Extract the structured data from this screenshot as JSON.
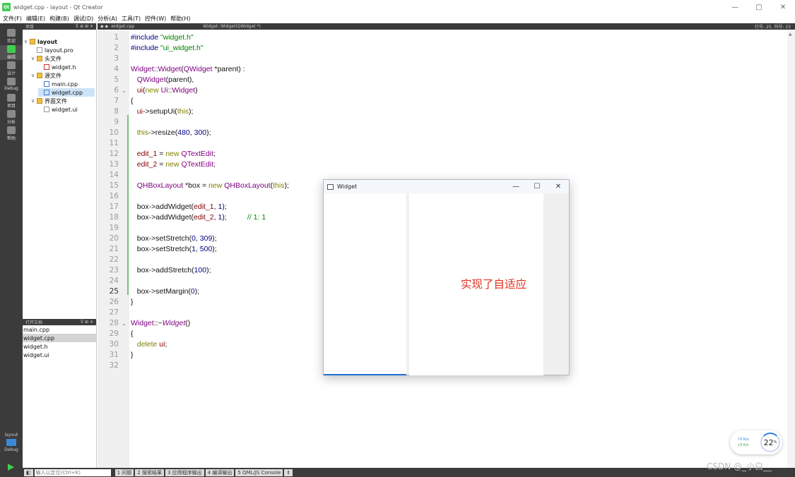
{
  "window": {
    "title": "widget.cpp - layout - Qt Creator",
    "app_icon": "Qt",
    "controls": [
      "—",
      "▢",
      "✕"
    ]
  },
  "menu": [
    "文件(F)",
    "编辑(E)",
    "构建(B)",
    "调试(D)",
    "分析(A)",
    "工具(T)",
    "控件(W)",
    "帮助(H)"
  ],
  "modes": [
    {
      "label": "欢迎",
      "active": false
    },
    {
      "label": "编辑",
      "active": true
    },
    {
      "label": "设计",
      "active": false
    },
    {
      "label": "Debug",
      "active": false
    },
    {
      "label": "项目",
      "active": false
    },
    {
      "label": "分析",
      "active": false
    },
    {
      "label": "帮助",
      "active": false
    }
  ],
  "kit": {
    "project": "layout",
    "config": "Debug"
  },
  "project_pane": {
    "header": "项目",
    "tree": [
      {
        "label": "layout",
        "depth": 0,
        "toggle": "∨",
        "icon": "project-folder-icon",
        "bold": true
      },
      {
        "label": "layout.pro",
        "depth": 1,
        "toggle": "",
        "icon": "pro-file-icon"
      },
      {
        "label": "头文件",
        "depth": 1,
        "toggle": "∨",
        "icon": "folder-icon"
      },
      {
        "label": "widget.h",
        "depth": 2,
        "toggle": "",
        "icon": "header-file-icon"
      },
      {
        "label": "源文件",
        "depth": 1,
        "toggle": "∨",
        "icon": "folder-icon"
      },
      {
        "label": "main.cpp",
        "depth": 2,
        "toggle": "",
        "icon": "cpp-file-icon"
      },
      {
        "label": "widget.cpp",
        "depth": 2,
        "toggle": "",
        "icon": "cpp-file-icon",
        "selected": true
      },
      {
        "label": "界面文件",
        "depth": 1,
        "toggle": "∨",
        "icon": "folder-icon"
      },
      {
        "label": "widget.ui",
        "depth": 2,
        "toggle": "",
        "icon": "ui-file-icon"
      }
    ]
  },
  "open_docs": {
    "header": "打开文档",
    "items": [
      {
        "label": "main.cpp",
        "selected": false
      },
      {
        "label": "widget.cpp",
        "selected": true
      },
      {
        "label": "widget.h",
        "selected": false
      },
      {
        "label": "widget.ui",
        "selected": false
      }
    ]
  },
  "editor": {
    "file": "widget.cpp",
    "function": "Widget::Widget(QWidget *)",
    "position": "行号: 25, 列号: 23",
    "current_line": 25,
    "line_numbers": [
      "1",
      "2",
      "3",
      "4",
      "5",
      "6",
      "7",
      "8",
      "9",
      "10",
      "11",
      "12",
      "13",
      "14",
      "15",
      "16",
      "17",
      "18",
      "19",
      "20",
      "21",
      "22",
      "23",
      "24",
      "25",
      "26",
      "27",
      "28",
      "29",
      "30",
      "31",
      "32"
    ],
    "folds": [
      {
        "line": 6,
        "symbol": "⌄"
      },
      {
        "line": 28,
        "symbol": "⌄"
      }
    ],
    "lines": [
      [
        [
          "#include ",
          "nm"
        ],
        [
          "\"widget.h\"",
          "st"
        ]
      ],
      [
        [
          "#include ",
          "nm"
        ],
        [
          "\"ui_widget.h\"",
          "st"
        ]
      ],
      [],
      [
        [
          "Widget",
          "ty"
        ],
        [
          "::",
          ""
        ],
        [
          "Widget",
          "ty"
        ],
        [
          "(",
          ""
        ],
        [
          "QWidget",
          "ty"
        ],
        [
          " *parent) :",
          ""
        ]
      ],
      [
        [
          "   ",
          ""
        ],
        [
          "QWidget",
          "ty"
        ],
        [
          "(parent),",
          ""
        ]
      ],
      [
        [
          "   ",
          ""
        ],
        [
          "ui",
          "vr"
        ],
        [
          "(",
          ""
        ],
        [
          "new ",
          "kw"
        ],
        [
          "Ui",
          "ty"
        ],
        [
          "::",
          ""
        ],
        [
          "Widget",
          "ty"
        ],
        [
          ")",
          ""
        ]
      ],
      [
        [
          "{",
          ""
        ]
      ],
      [
        [
          "   ",
          ""
        ],
        [
          "ui",
          "vr"
        ],
        [
          "->setupUi(",
          ""
        ],
        [
          "this",
          "kw"
        ],
        [
          ");",
          ""
        ]
      ],
      [],
      [
        [
          "   ",
          ""
        ],
        [
          "this",
          "kw"
        ],
        [
          "->resize(",
          ""
        ],
        [
          "480",
          "nm"
        ],
        [
          ", ",
          ""
        ],
        [
          "300",
          "nm"
        ],
        [
          ");",
          ""
        ]
      ],
      [],
      [
        [
          "   ",
          ""
        ],
        [
          "edit_1",
          "vr"
        ],
        [
          " = ",
          ""
        ],
        [
          "new ",
          "kw"
        ],
        [
          "QTextEdit",
          "ty"
        ],
        [
          ";",
          ""
        ]
      ],
      [
        [
          "   ",
          ""
        ],
        [
          "edit_2",
          "vr"
        ],
        [
          " = ",
          ""
        ],
        [
          "new ",
          "kw"
        ],
        [
          "QTextEdit",
          "ty"
        ],
        [
          ";",
          ""
        ]
      ],
      [],
      [
        [
          "   ",
          ""
        ],
        [
          "QHBoxLayout",
          "ty"
        ],
        [
          " *box = ",
          ""
        ],
        [
          "new ",
          "kw"
        ],
        [
          "QHBoxLayout",
          "ty"
        ],
        [
          "(",
          ""
        ],
        [
          "this",
          "kw"
        ],
        [
          ");",
          ""
        ]
      ],
      [],
      [
        [
          "   box->addWidget(",
          ""
        ],
        [
          "edit_1",
          "vr"
        ],
        [
          ", ",
          ""
        ],
        [
          "1",
          "nm"
        ],
        [
          ");",
          ""
        ]
      ],
      [
        [
          "   box->addWidget(",
          ""
        ],
        [
          "edit_2",
          "vr"
        ],
        [
          ", ",
          ""
        ],
        [
          "1",
          "nm"
        ],
        [
          ");          ",
          ""
        ],
        [
          "// 1: 1",
          "cm"
        ]
      ],
      [],
      [
        [
          "   box->setStretch(",
          ""
        ],
        [
          "0",
          "nm"
        ],
        [
          ", ",
          ""
        ],
        [
          "309",
          "nm"
        ],
        [
          ");",
          ""
        ]
      ],
      [
        [
          "   box->setStretch(",
          ""
        ],
        [
          "1",
          "nm"
        ],
        [
          ", ",
          ""
        ],
        [
          "500",
          "nm"
        ],
        [
          ");",
          ""
        ]
      ],
      [],
      [
        [
          "   box->addStretch(",
          ""
        ],
        [
          "100",
          "nm"
        ],
        [
          ");",
          ""
        ]
      ],
      [],
      [
        [
          "   box->setMargin(",
          ""
        ],
        [
          "0",
          "nm"
        ],
        [
          ");",
          ""
        ]
      ],
      [
        [
          "}",
          ""
        ]
      ],
      [],
      [
        [
          "Widget",
          "ty"
        ],
        [
          "::~",
          ""
        ],
        [
          "Widget",
          "ty it"
        ],
        [
          "()",
          ""
        ]
      ],
      [
        [
          "{",
          ""
        ]
      ],
      [
        [
          "   ",
          ""
        ],
        [
          "delete ",
          "kw"
        ],
        [
          "ui",
          "vr"
        ],
        [
          ";",
          ""
        ]
      ],
      [
        [
          "}",
          ""
        ]
      ],
      []
    ]
  },
  "status_bar": {
    "toggle": "◧",
    "locator_placeholder": "输入以定位(Ctrl+K)",
    "tabs": [
      "1 问题",
      "2 搜索结果",
      "3 应用程序输出",
      "4 编译输出",
      "5 QML/JS Console"
    ],
    "more": "⇕"
  },
  "widget_window": {
    "title": "Widget",
    "controls": [
      "—",
      "☐",
      "✕"
    ],
    "caption": "实现了自适应"
  },
  "speed_widget": {
    "up_rate": "↑0 K/s",
    "down_rate": "↓0 K/s",
    "percent": "22",
    "percent_unit": "%"
  },
  "watermark": "CSDN @_小白__"
}
